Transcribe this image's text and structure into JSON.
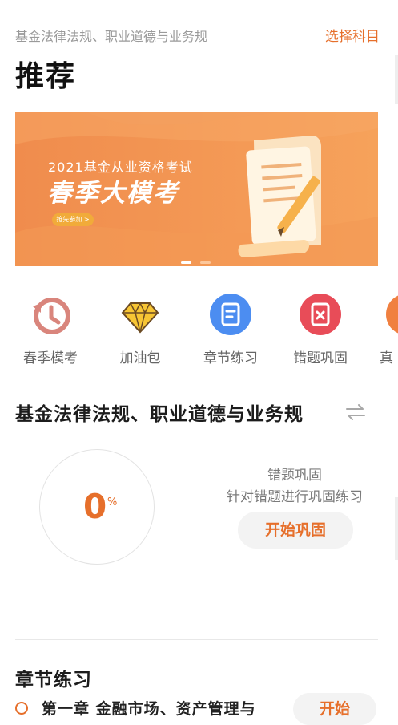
{
  "header": {
    "subject": "基金法律法规、职业道德与业务规",
    "select_subject": "选择科目",
    "title": "推荐"
  },
  "banner": {
    "line1": "2021基金从业资格考试",
    "line2": "春季大模考",
    "cta": "抢先参加 >"
  },
  "carousel": {
    "active_index": 0,
    "count": 2
  },
  "shortcuts": [
    {
      "label": "春季模考",
      "icon": "clock-rewind-icon"
    },
    {
      "label": "加油包",
      "icon": "diamond-icon"
    },
    {
      "label": "章节练习",
      "icon": "notebook-icon"
    },
    {
      "label": "错题巩固",
      "icon": "error-book-icon"
    },
    {
      "label": "真",
      "icon": "partial-icon"
    }
  ],
  "practice": {
    "subject": "基金法律法规、职业道德与业务规",
    "progress_value": "0",
    "progress_unit": "%",
    "mode_title": "错题巩固",
    "mode_desc": "针对错题进行巩固练习",
    "start_label": "开始巩固"
  },
  "chapters": {
    "title": "章节练习",
    "first_item": "第一章  金融市场、资产管理与",
    "start_label": "开始"
  },
  "colors": {
    "accent": "#e66f2b",
    "banner_start": "#f08c4d",
    "banner_end": "#f6a25b"
  }
}
